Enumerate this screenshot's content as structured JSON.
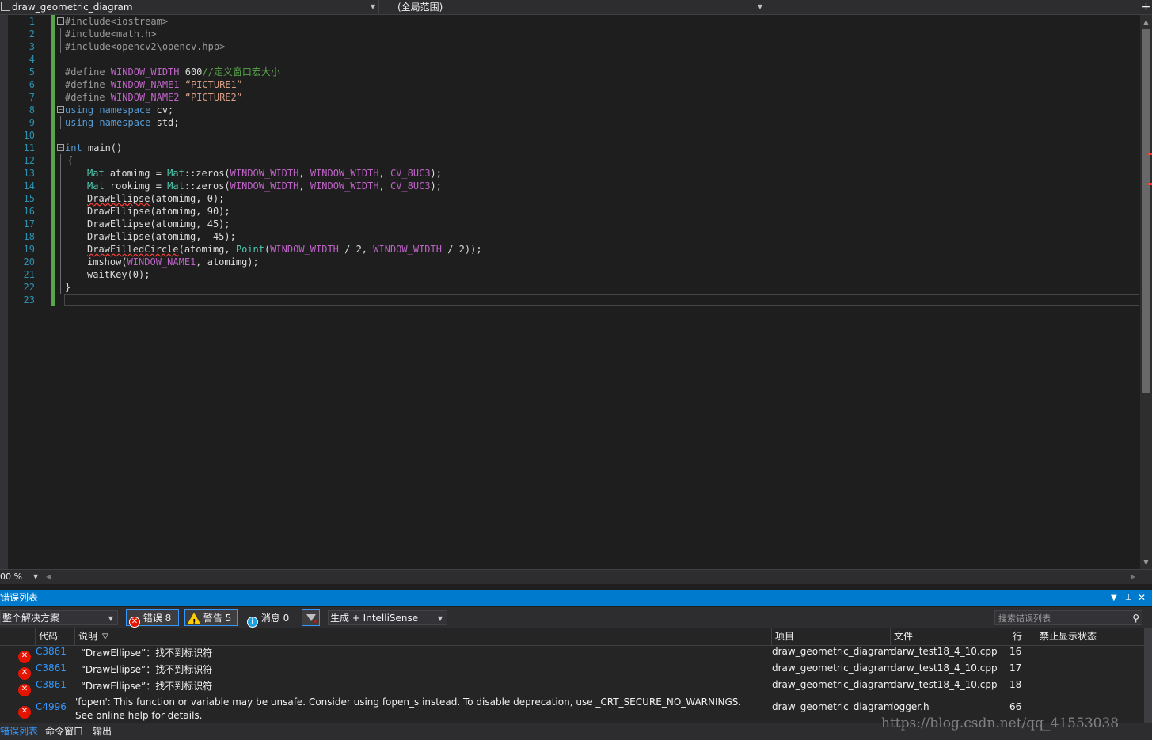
{
  "top": {
    "file_combo": "draw_geometric_diagram",
    "scope_combo": "(全局范围)",
    "split_icon": "+"
  },
  "code_lines": [
    {
      "n": "1"
    },
    {
      "n": "2"
    },
    {
      "n": "3"
    },
    {
      "n": "4"
    },
    {
      "n": "5"
    },
    {
      "n": "6"
    },
    {
      "n": "7"
    },
    {
      "n": "8"
    },
    {
      "n": "9"
    },
    {
      "n": "10"
    },
    {
      "n": "11"
    },
    {
      "n": "12"
    },
    {
      "n": "13"
    },
    {
      "n": "14"
    },
    {
      "n": "15"
    },
    {
      "n": "16"
    },
    {
      "n": "17"
    },
    {
      "n": "18"
    },
    {
      "n": "19"
    },
    {
      "n": "20"
    },
    {
      "n": "21"
    },
    {
      "n": "22"
    },
    {
      "n": "23"
    }
  ],
  "code": {
    "l1": "#include<iostream>",
    "l2": "#include<math.h>",
    "l3": "#include<opencv2\\opencv.hpp>",
    "l5_pp": "#define ",
    "l5_mac": "WINDOW_WIDTH",
    "l5_val": " 600",
    "l5_cmt": "//定义窗口宏大小",
    "l6_pp": "#define ",
    "l6_mac": "WINDOW_NAME1",
    "l6_str": " “PICTURE1”",
    "l7_pp": "#define ",
    "l7_mac": "WINDOW_NAME2",
    "l7_str": " “PICTURE2”",
    "l8_kw": "using namespace",
    "l8_rest": " cv;",
    "l9_kw": "using namespace",
    "l9_rest": " std;",
    "l11_kw": "int",
    "l11_rest": " main()",
    "l12": "{",
    "l13_typ": "Mat",
    "l13_a": " atomimg = ",
    "l13_typ2": "Mat",
    "l13_b": "::zeros(",
    "l13_m1": "WINDOW_WIDTH",
    "l13_c": ", ",
    "l13_m2": "WINDOW_WIDTH",
    "l13_d": ", ",
    "l13_m3": "CV_8UC3",
    "l13_e": ");",
    "l14_typ": "Mat",
    "l14_a": " rookimg = ",
    "l14_typ2": "Mat",
    "l14_b": "::zeros(",
    "l14_m1": "WINDOW_WIDTH",
    "l14_c": ", ",
    "l14_m2": "WINDOW_WIDTH",
    "l14_d": ", ",
    "l14_m3": "CV_8UC3",
    "l14_e": ");",
    "l15_fn": "DrawEllipse",
    "l15_rest": "(atomimg, 0);",
    "l16": "DrawEllipse(atomimg, 90);",
    "l17": "DrawEllipse(atomimg, 45);",
    "l18": "DrawEllipse(atomimg, -45);",
    "l19_fn": "DrawFilledCircle",
    "l19_a": "(atomimg, ",
    "l19_typ": "Point",
    "l19_b": "(",
    "l19_m1": "WINDOW_WIDTH",
    "l19_c": " / 2, ",
    "l19_m2": "WINDOW_WIDTH",
    "l19_d": " / 2));",
    "l20_a": "imshow(",
    "l20_mac": "WINDOW_NAME1",
    "l20_b": ", atomimg);",
    "l21": "waitKey(0);",
    "l22": "}"
  },
  "status": {
    "zoom": "00 %"
  },
  "panel": {
    "title": "错误列表",
    "scope": "整个解决方案",
    "errors_btn": "错误 8",
    "warnings_btn": "警告 5",
    "messages_btn": "消息 0",
    "build_combo": "生成 + IntelliSense",
    "search_placeholder": "搜索错误列表"
  },
  "columns": {
    "code": "代码",
    "desc": "说明",
    "project": "项目",
    "file": "文件",
    "line": "行",
    "suppress": "禁止显示状态"
  },
  "errors": [
    {
      "code": "C3861",
      "desc": "“DrawEllipse”：找不到标识符",
      "project": "draw_geometric_diagram",
      "file": "darw_test18_4_10.cpp",
      "line": "16"
    },
    {
      "code": "C3861",
      "desc": "“DrawEllipse”：找不到标识符",
      "project": "draw_geometric_diagram",
      "file": "darw_test18_4_10.cpp",
      "line": "17"
    },
    {
      "code": "C3861",
      "desc": "“DrawEllipse”：找不到标识符",
      "project": "draw_geometric_diagram",
      "file": "darw_test18_4_10.cpp",
      "line": "18"
    },
    {
      "code": "C4996",
      "desc": "'fopen': This function or variable may be unsafe. Consider using fopen_s instead. To disable deprecation, use _CRT_SECURE_NO_WARNINGS. See online help for details.",
      "project": "draw_geometric_diagram",
      "file": "logger.h",
      "line": "66"
    }
  ],
  "bottom_tabs": {
    "errors": "错误列表",
    "command": "命令窗口",
    "output": "输出"
  },
  "watermark": "https://blog.csdn.net/qq_41553038",
  "colors": {
    "accent": "#007acc",
    "editor_bg": "#1e1e1e",
    "error": "#e51400",
    "warning": "#ffcc00",
    "link": "#3399ff"
  }
}
